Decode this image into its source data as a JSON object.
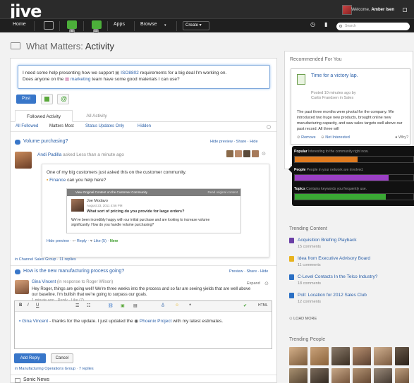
{
  "header": {
    "logo": "jive",
    "welcome_prefix": "Welcome,",
    "user_name": "Amber Isen",
    "nav": {
      "home": "Home",
      "apps": "Apps",
      "browse": "Browse",
      "create": "Create"
    },
    "badges": [
      "6",
      "13"
    ],
    "search_placeholder": "Search"
  },
  "page": {
    "title_prefix": "What Matters:",
    "title_main": "Activity"
  },
  "composer": {
    "line1_prefix": "I need some help presenting how we support",
    "line1_link": "ISO8802",
    "line1_suffix": "requirements for a big deal I'm working on.",
    "line2_prefix": "Does anyone on the",
    "line2_link": "marketing",
    "line2_suffix": "team have some good materials I can use?",
    "post_label": "Post"
  },
  "tabs": [
    {
      "label": "Followed Activity"
    },
    {
      "label": "All Activity"
    }
  ],
  "filters": [
    "All Followed",
    "Matters Most",
    "Status Updates Only",
    "Hidden"
  ],
  "item1": {
    "title": "Volume purchasing?",
    "links": "Hide preview · Share · Hide",
    "author": "Andi Padilla",
    "meta": "asked Less than a minute ago",
    "question": "One of my big customers just asked this on the customer community.",
    "place_link": "Finance",
    "place_suffix": "can you help here?",
    "embedded_head": "View Original Content on the Customer Community",
    "embedded_head_right": "Read original content",
    "emb_author": "Joe Modavo",
    "emb_date": "August 23, 2011 4:56 PM",
    "emb_title": "What sort of pricing do you provide for large orders?",
    "emb_body1": "We've been incredibly happy with our initial purchase and are looking to increase volume",
    "emb_body2": "significantly. How do you handle volume purchasing?",
    "foot_hide": "Hide preview",
    "foot_reply": "Reply",
    "foot_like": "Like (5)",
    "foot_new": "New",
    "place": "in Channel Sales Group",
    "replies": "11 replies"
  },
  "item2": {
    "title": "How is the new manufacturing process going?",
    "links": "Preview · Share · Hide",
    "expand": "Expand",
    "author": "Gina Vincent",
    "meta": "(in response to Roger Wilson)",
    "body1": "Hey Roger, things are going well! We're three weeks into the process and so far are seeing yields that are well above",
    "body2": "our baseline. I'm bullish that we're going to surpass our goals.",
    "foot": "1 minute ago · Reply · Like (7)",
    "reply_prefix": "Gina Vincent",
    "reply_mid": "- thanks for the update. I just updated the",
    "reply_link": "Phoenix Project",
    "reply_suffix": "with my latest estimates.",
    "add_reply": "Add Reply",
    "cancel": "Cancel",
    "place": "in Manufacturing Operations Group",
    "replies": "7 replies"
  },
  "recommended": {
    "heading": "Recommended For You",
    "card_title": "Time for a victory lap.",
    "card_meta1": "Posted 10 minutes ago by",
    "card_meta2": "Curtis Frandsen in Sales",
    "card_body": "The past three months were pivotal for the company. We introduced two huge new products, brought online new manufacturing capacity, and saw sales targets well above our past record. All three will",
    "remove": "Remove",
    "not_interested": "Not Interested",
    "why": "Why?"
  },
  "tooltip": {
    "rows": [
      {
        "label": "Popular",
        "desc": "Interesting to the community right now.",
        "color": "#e07b1f",
        "fill": 0.53
      },
      {
        "label": "People",
        "desc": "People in your network are involved.",
        "color": "#9a3fc4",
        "fill": 0.79
      },
      {
        "label": "Topics",
        "desc": "Contains keywords you frequently use.",
        "color": "#3aa834",
        "fill": 0.77
      }
    ]
  },
  "trending": {
    "heading": "Trending Content",
    "items": [
      {
        "title": "Acquisition Briefing Playback",
        "comments": "15 comments",
        "color": "#6a3fa6"
      },
      {
        "title": "Idea from Executive Advisory Board",
        "comments": "11 comments",
        "color": "#e8b31f"
      },
      {
        "title": "C-Level Contacts In the Telco Industry?",
        "comments": "18 comments",
        "color": "#2a6fc4"
      },
      {
        "title": "Poll: Location for 2012 Sales Club",
        "comments": "12 comments",
        "color": "#2a6fc4"
      }
    ],
    "load_more": "LOAD MORE"
  },
  "people": {
    "heading": "Trending People"
  },
  "bottom": {
    "label": "Sonic News"
  }
}
